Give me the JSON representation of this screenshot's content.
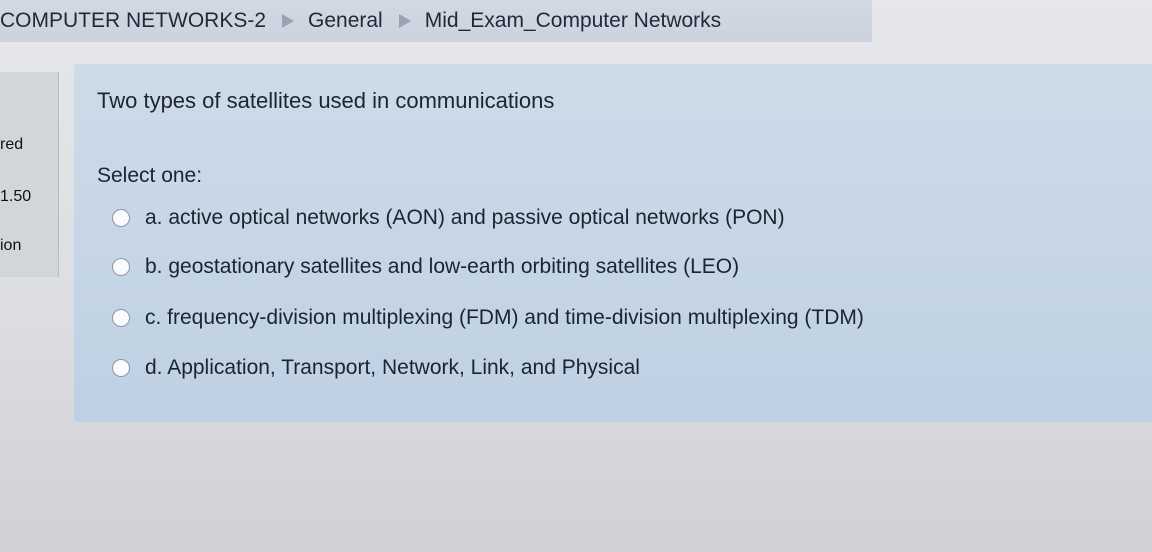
{
  "breadcrumb": {
    "items": [
      {
        "label": "COMPUTER NETWORKS-2"
      },
      {
        "label": "General"
      },
      {
        "label": "Mid_Exam_Computer Networks"
      }
    ]
  },
  "sidebar": {
    "status_fragment": "red",
    "marks_fragment": "1.50",
    "flag_fragment": "ion"
  },
  "question": {
    "text": "Two types of satellites used in communications",
    "prompt": "Select one:",
    "options": [
      {
        "label": "a. active optical networks (AON) and passive optical networks (PON)",
        "selected": false
      },
      {
        "label": "b. geostationary satellites and low-earth orbiting satellites (LEO)",
        "selected": false
      },
      {
        "label": "c. frequency-division multiplexing (FDM) and time-division multiplexing (TDM)",
        "selected": false
      },
      {
        "label": "d. Application, Transport, Network, Link, and Physical",
        "selected": false
      }
    ]
  },
  "icons": {
    "breadcrumb_separator": "triangle-right-icon",
    "option_radio": "radio-button-icon"
  },
  "colors": {
    "question_bg": "#c6d6e6",
    "breadcrumb_bg": "#d3d8e3"
  }
}
